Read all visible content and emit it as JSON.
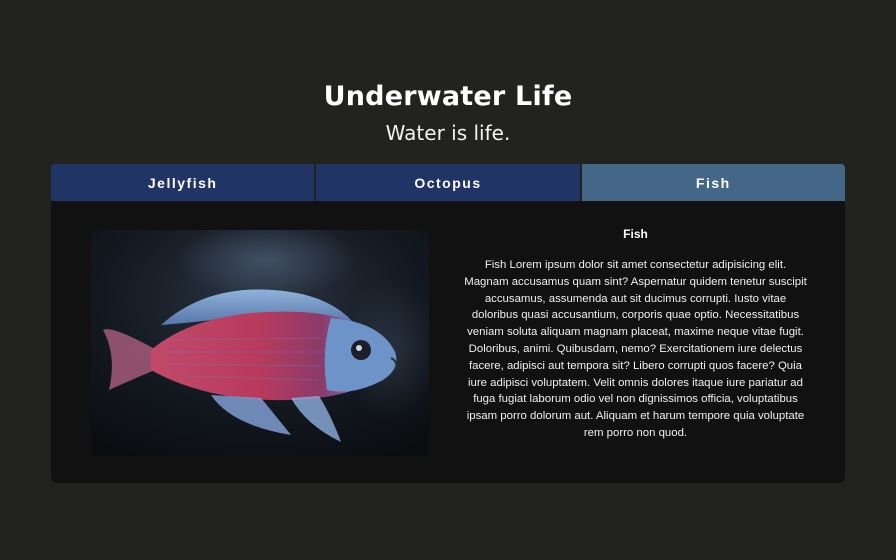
{
  "header": {
    "title": "Underwater Life",
    "subtitle": "Water is life."
  },
  "tabs": [
    {
      "label": "Jellyfish",
      "active": false
    },
    {
      "label": "Octopus",
      "active": false
    },
    {
      "label": "Fish",
      "active": true
    }
  ],
  "panel": {
    "heading": "Fish",
    "body": "Fish Lorem ipsum dolor sit amet consectetur adipisicing elit. Magnam accusamus quam sint? Aspernatur quidem tenetur suscipit accusamus, assumenda aut sit ducimus corrupti. Iusto vitae doloribus quasi accusantium, corporis quae optio. Necessitatibus veniam soluta aliquam magnam placeat, maxime neque vitae fugit. Doloribus, animi. Quibusdam, nemo? Exercitationem iure delectus facere, adipisci aut tempora sit? Libero corrupti quos facere? Quia iure adipisci voluptatem. Velit omnis dolores itaque iure pariatur ad fuga fugiat laborum odio vel non dignissimos officia, voluptatibus ipsam porro dolorum aut. Aliquam et harum tempore quia voluptate rem porro non quod."
  },
  "colors": {
    "page_background": "#22221e",
    "tab_background": "#203466",
    "tab_active_background": "#456787",
    "panel_background": "#111111"
  }
}
